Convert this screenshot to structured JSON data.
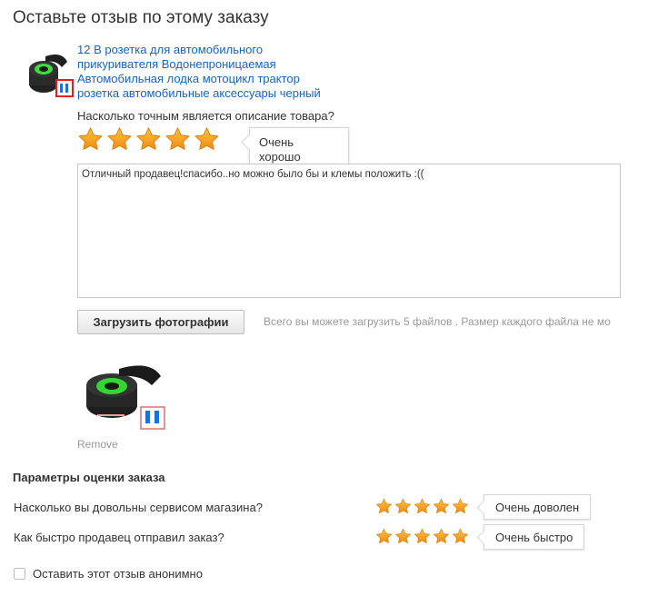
{
  "page": {
    "title": "Оставьте отзыв по этому заказу"
  },
  "product": {
    "link_line1": "12 В розетка для автомобильного",
    "link_line2": "прикуривателя Водонепроницаемая",
    "link_line3": "Автомобильная лодка мотоцикл трактор",
    "link_line4": "розетка автомобильные аксессуары черный",
    "thumb_icon": "car-socket-image"
  },
  "description_rating": {
    "question": "Насколько точным является описание товара?",
    "stars": 5,
    "max": 5,
    "tooltip_line1": "Очень",
    "tooltip_line2": "хорошо"
  },
  "review": {
    "text": "Отличный продавец!спасибо..но можно было бы и клемы положить :(("
  },
  "upload": {
    "button_label": "Загрузить фотографии",
    "note": "Всего вы можете загрузить 5 файлов . Размер каждого файла не мо"
  },
  "photo": {
    "remove_label": "Remove"
  },
  "order_params": {
    "title": "Параметры оценки заказа",
    "rows": [
      {
        "question": "Насколько вы довольны сервисом магазина?",
        "stars": 5,
        "max": 5,
        "verdict": "Очень доволен"
      },
      {
        "question": "Как быстро продавец отправил заказ?",
        "stars": 5,
        "max": 5,
        "verdict": "Очень быстро"
      }
    ]
  },
  "anonymous": {
    "label": "Оставить этот отзыв анонимно",
    "checked": false
  },
  "colors": {
    "link": "#1565c0",
    "star": "#f5a623",
    "star_edge": "#e38a11",
    "muted": "#999999"
  }
}
